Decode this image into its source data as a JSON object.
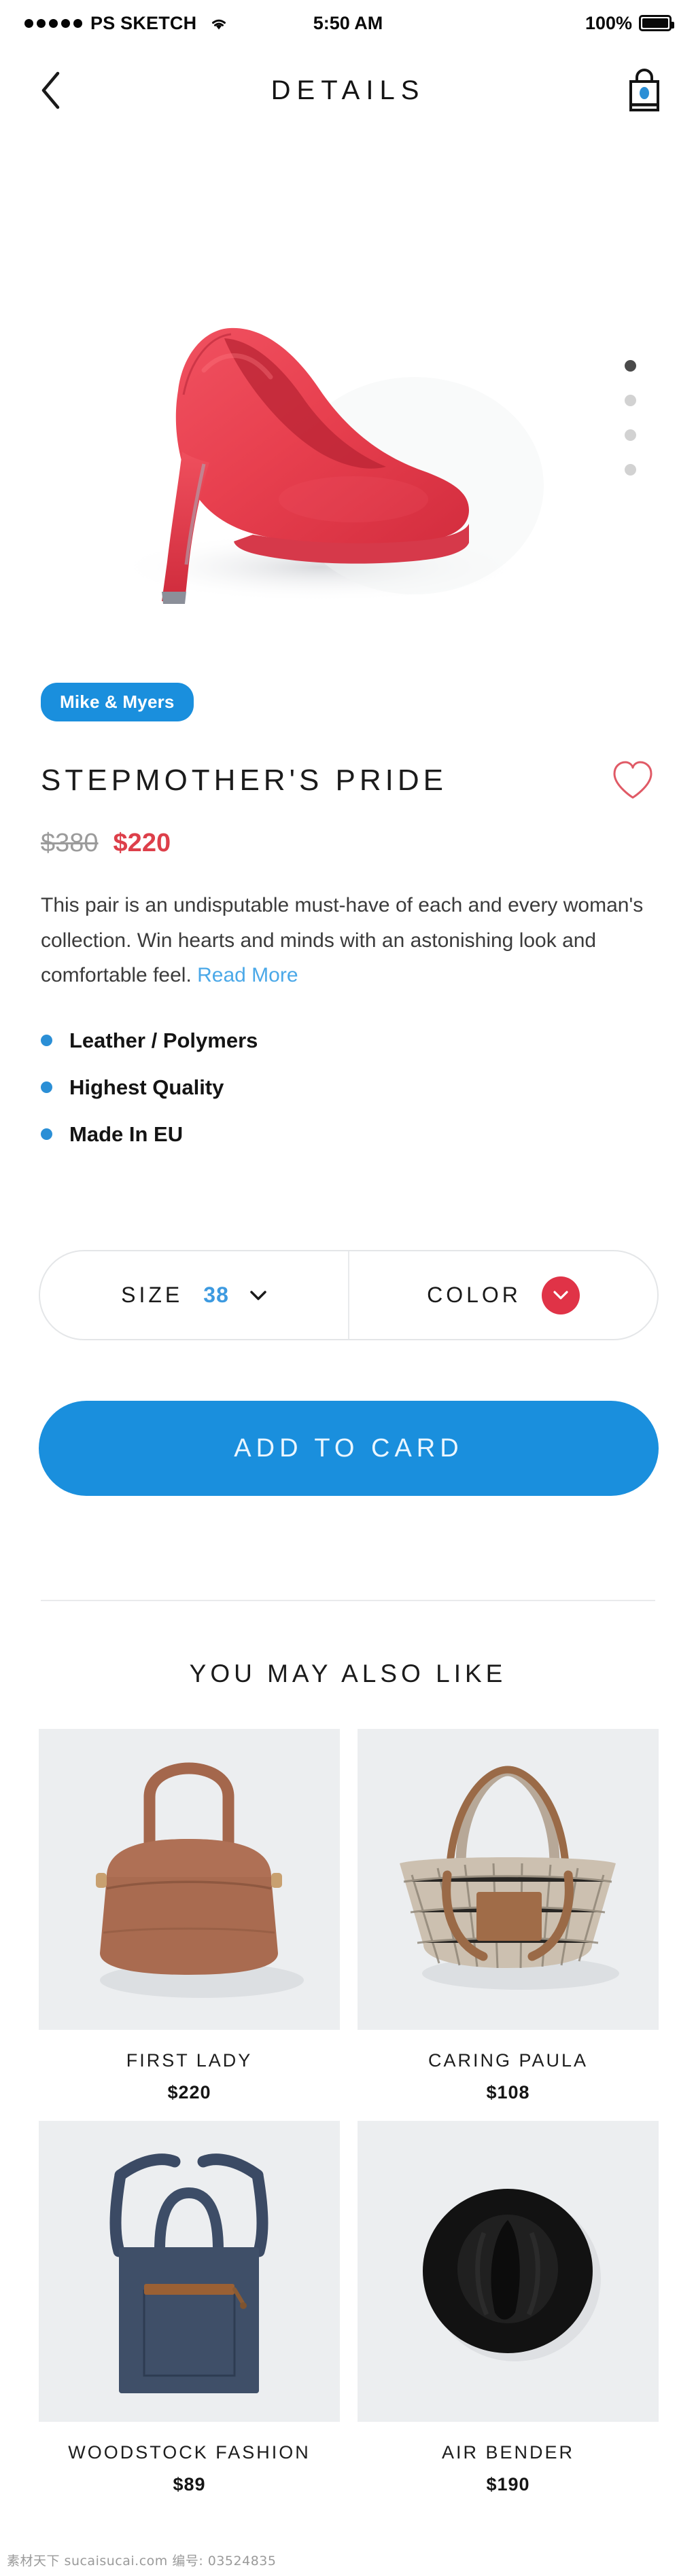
{
  "status_bar": {
    "signal_dots": 5,
    "carrier": "PS SKETCH",
    "wifi_icon": "wifi-icon",
    "time": "5:50 AM",
    "battery_percent": "100%",
    "battery_icon": "battery-full-icon"
  },
  "header": {
    "back_icon": "chevron-left-icon",
    "title": "DETAILS",
    "bag_icon": "shopping-bag-icon"
  },
  "hero": {
    "product_image_alt": "red-high-heel-shoe",
    "carousel": {
      "total": 4,
      "active_index": 0
    }
  },
  "product": {
    "brand_badge": "Mike & Myers",
    "title": "STEPMOTHER'S PRIDE",
    "favorite_icon": "heart-outline-icon",
    "price_old": "$380",
    "price_new": "$220",
    "description": "This pair is an undisputable must-have of each and every woman's collection. Win hearts and minds with an astonishing look and comfortable feel.",
    "read_more": "Read More",
    "features": [
      "Leather / Polymers",
      "Highest Quality",
      "Made In EU"
    ]
  },
  "selector": {
    "size_label": "SIZE",
    "size_value": "38",
    "size_chevron_icon": "chevron-down-icon",
    "color_label": "COLOR",
    "color_swatch_hex": "#e03347",
    "color_chevron_icon": "chevron-down-icon"
  },
  "cta": {
    "label": "ADD TO CARD"
  },
  "also_like": {
    "heading": "YOU MAY ALSO LIKE",
    "items": [
      {
        "name": "FIRST LADY",
        "price": "$220",
        "image_alt": "brown-leather-handbag"
      },
      {
        "name": "CARING PAULA",
        "price": "$108",
        "image_alt": "woven-straw-basket-tote"
      },
      {
        "name": "WOODSTOCK FASHION",
        "price": "$89",
        "image_alt": "navy-denim-tote-bag"
      },
      {
        "name": "AIR BENDER",
        "price": "$190",
        "image_alt": "black-fedora-hat"
      }
    ]
  },
  "watermark": "素材天下 sucaisucai.com  编号: 03524835",
  "colors": {
    "accent_blue": "#1a8fdd",
    "price_red": "#dd3f4a",
    "swatch_red": "#e03347",
    "link_blue": "#4aa8e8",
    "thumb_bg": "#eceef0"
  }
}
